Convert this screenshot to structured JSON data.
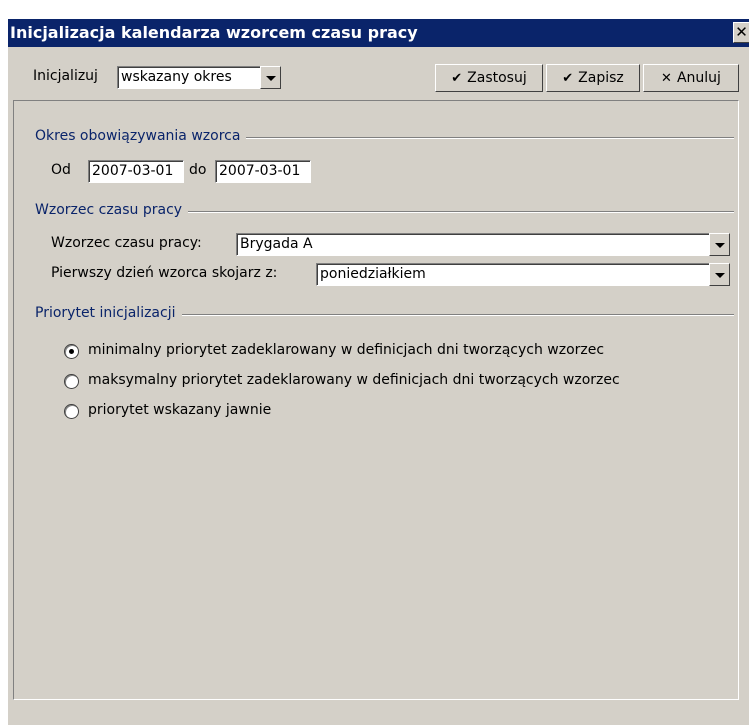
{
  "window": {
    "title": "Inicjalizacja kalendarza wzorcem czasu pracy",
    "close_glyph": "✕"
  },
  "toolbar": {
    "init_label": "Inicjalizuj",
    "init_value": "wskazany okres",
    "apply_label": "Zastosuj",
    "save_label": "Zapisz",
    "cancel_label": "Anuluj",
    "check_glyph": "✔",
    "cross_glyph": "✕"
  },
  "period_group": {
    "title": "Okres obowiązywania wzorca",
    "from_label": "Od",
    "from_value": "2007-03-01",
    "to_label": "do",
    "to_value": "2007-03-01"
  },
  "pattern_group": {
    "title": "Wzorzec czasu pracy",
    "pattern_label": "Wzorzec czasu pracy:",
    "pattern_value": "Brygada A",
    "first_day_label": "Pierwszy dzień wzorca skojarz z:",
    "first_day_value": "poniedziałkiem"
  },
  "priority_group": {
    "title": "Priorytet inicjalizacji",
    "options": [
      {
        "label": "minimalny priorytet zadeklarowany w definicjach dni tworzących wzorzec",
        "selected": true
      },
      {
        "label": "maksymalny priorytet zadeklarowany w definicjach dni tworzących wzorzec",
        "selected": false
      },
      {
        "label": "priorytet wskazany jawnie",
        "selected": false
      }
    ]
  },
  "colors": {
    "titlebar": "#0a246a",
    "face": "#d4d0c8",
    "group_title": "#0a246a"
  }
}
